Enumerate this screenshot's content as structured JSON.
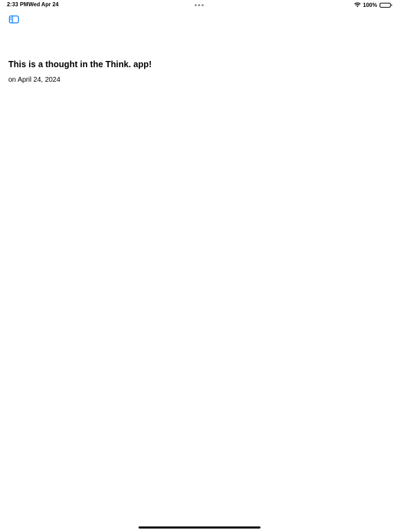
{
  "status_bar": {
    "time": "2:33 PM",
    "date": "Wed Apr 24",
    "battery_percent": "100%",
    "battery_level": 1.0,
    "icons": [
      "wifi-icon",
      "battery-icon",
      "multitask-dots-icon"
    ]
  },
  "toolbar": {
    "sidebar_toggle_icon": "sidebar-icon",
    "accent_color": "#007AFF"
  },
  "thought": {
    "title": "This is a thought in the Think. app!",
    "date": "on April 24, 2024"
  }
}
